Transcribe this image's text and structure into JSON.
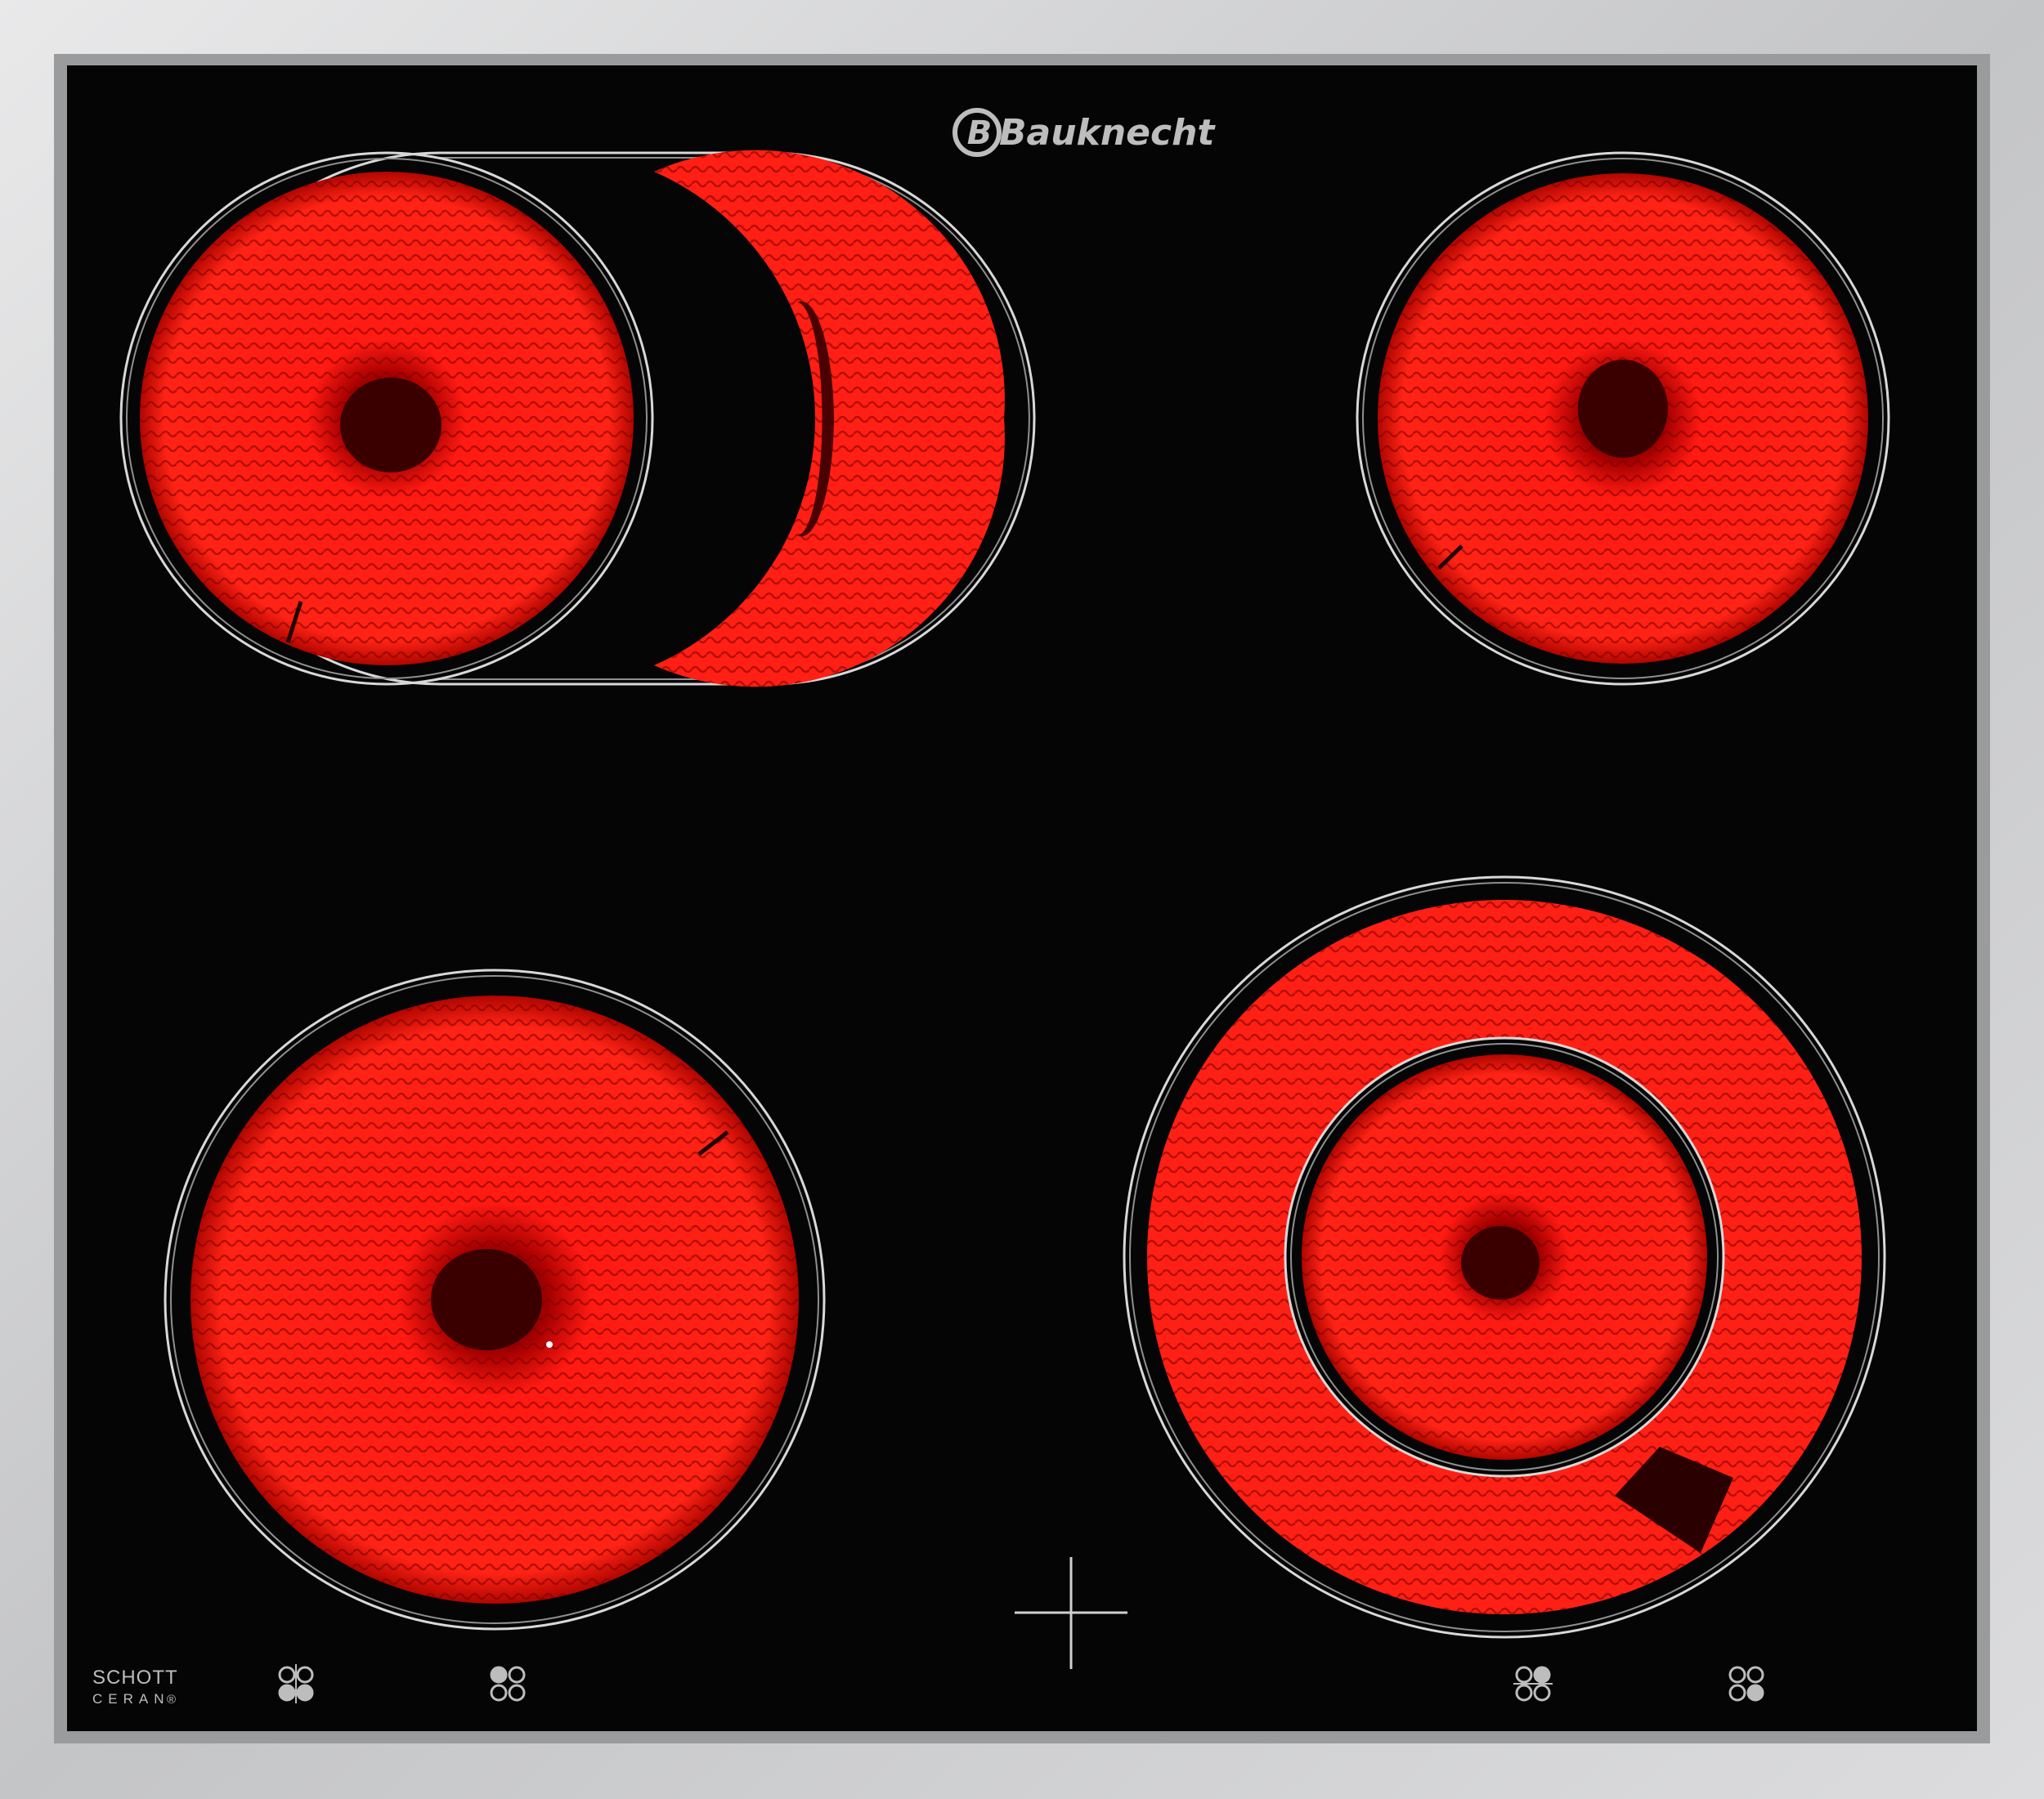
{
  "brand": {
    "name": "Bauknecht",
    "mark_letter": "B"
  },
  "glass_label": {
    "line1": "SCHOTT",
    "line2": "CERAN",
    "registered": "®"
  },
  "cooking_zones": [
    {
      "id": "front-left-extended-zone",
      "type": "dual-oval",
      "state": "glowing"
    },
    {
      "id": "rear-right-zone",
      "type": "single-round",
      "state": "glowing"
    },
    {
      "id": "front-left-zone",
      "type": "single-round",
      "state": "glowing"
    },
    {
      "id": "front-right-dual-zone",
      "type": "dual-round",
      "state": "glowing"
    }
  ],
  "zone_indicators": [
    {
      "id": "indicator-1",
      "highlight": [
        "bottom-left",
        "bottom-right"
      ]
    },
    {
      "id": "indicator-2",
      "highlight": [
        "top-left"
      ]
    },
    {
      "id": "indicator-3",
      "highlight": [
        "top-right"
      ]
    },
    {
      "id": "indicator-4",
      "highlight": [
        "bottom-right"
      ]
    }
  ],
  "colors": {
    "frame": "#cfd0d2",
    "glass": "#050505",
    "heat": "#ff1a12",
    "heat_dark": "#6a0000",
    "ring_line": "#d8d8d8",
    "print": "#bdbdbd"
  }
}
